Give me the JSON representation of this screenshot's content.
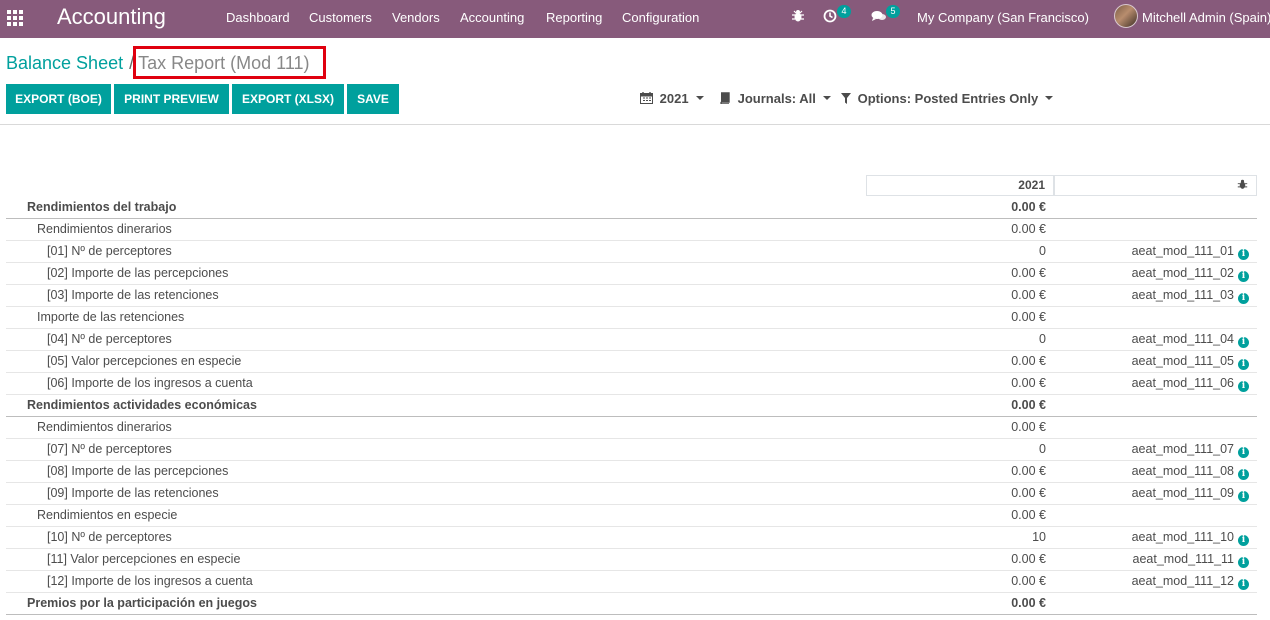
{
  "navbar": {
    "brand": "Accounting",
    "menu": [
      "Dashboard",
      "Customers",
      "Vendors",
      "Accounting",
      "Reporting",
      "Configuration"
    ],
    "activity_count": "4",
    "messages_count": "5",
    "company": "My Company (San Francisco)",
    "user": "Mitchell Admin (Spain)"
  },
  "breadcrumb": {
    "parent": "Balance Sheet",
    "separator": "/",
    "current": "Tax Report (Mod 111)"
  },
  "buttons": {
    "export_boe": "EXPORT (BOE)",
    "print_preview": "PRINT PREVIEW",
    "export_xlsx": "EXPORT (XLSX)",
    "save": "SAVE"
  },
  "filters": {
    "date": "2021",
    "journals": "Journals: All",
    "options": "Options: Posted Entries Only"
  },
  "table": {
    "column_header": "2021",
    "rows": [
      {
        "name": "Rendimientos del trabajo",
        "value": "0.00 €",
        "tag": ""
      },
      {
        "name": "Rendimientos dinerarios",
        "value": "0.00 €",
        "tag": ""
      },
      {
        "name": "[01] Nº de perceptores",
        "value": "0",
        "tag": "aeat_mod_111_01"
      },
      {
        "name": "[02] Importe de las percepciones",
        "value": "0.00 €",
        "tag": "aeat_mod_111_02"
      },
      {
        "name": "[03] Importe de las retenciones",
        "value": "0.00 €",
        "tag": "aeat_mod_111_03"
      },
      {
        "name": "Importe de las retenciones",
        "value": "0.00 €",
        "tag": ""
      },
      {
        "name": "[04] Nº de perceptores",
        "value": "0",
        "tag": "aeat_mod_111_04"
      },
      {
        "name": "[05] Valor percepciones en especie",
        "value": "0.00 €",
        "tag": "aeat_mod_111_05"
      },
      {
        "name": "[06] Importe de los ingresos a cuenta",
        "value": "0.00 €",
        "tag": "aeat_mod_111_06"
      },
      {
        "name": "Rendimientos actividades económicas",
        "value": "0.00 €",
        "tag": ""
      },
      {
        "name": "Rendimientos dinerarios",
        "value": "0.00 €",
        "tag": ""
      },
      {
        "name": "[07] Nº de perceptores",
        "value": "0",
        "tag": "aeat_mod_111_07"
      },
      {
        "name": "[08] Importe de las percepciones",
        "value": "0.00 €",
        "tag": "aeat_mod_111_08"
      },
      {
        "name": "[09] Importe de las retenciones",
        "value": "0.00 €",
        "tag": "aeat_mod_111_09"
      },
      {
        "name": "Rendimientos en especie",
        "value": "0.00 €",
        "tag": ""
      },
      {
        "name": "[10] Nº de perceptores",
        "value": "10",
        "tag": "aeat_mod_111_10"
      },
      {
        "name": "[11] Valor percepciones en especie",
        "value": "0.00 €",
        "tag": "aeat_mod_111_11"
      },
      {
        "name": "[12] Importe de los ingresos a cuenta",
        "value": "0.00 €",
        "tag": "aeat_mod_111_12"
      },
      {
        "name": "Premios por la participación en juegos",
        "value": "0.00 €",
        "tag": ""
      }
    ]
  }
}
